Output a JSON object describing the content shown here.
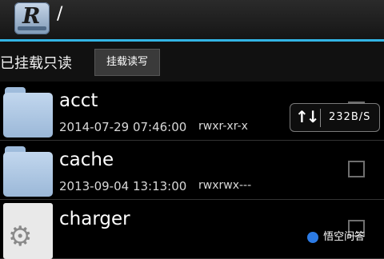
{
  "header": {
    "app_icon": "root-explorer-r-icon",
    "path": "/"
  },
  "mount_bar": {
    "status": "已挂载只读",
    "button_label": "挂载读写"
  },
  "files": [
    {
      "name": "acct",
      "date": "2014-07-29 07:46:00",
      "permissions": "rwxr-xr-x",
      "icon": "folder-icon"
    },
    {
      "name": "cache",
      "date": "2013-09-04 13:13:00",
      "permissions": "rwxrwx---",
      "icon": "folder-icon"
    },
    {
      "name": "charger",
      "date": "",
      "permissions": "",
      "icon": "settings-file-icon"
    }
  ],
  "speed_widget": {
    "arrows_icon": "up-down-arrows-icon",
    "value": "232B/S"
  },
  "watermark": {
    "text": "悟空问答"
  },
  "colors": {
    "accent": "#33b5e5",
    "folder": "#a9c5e4"
  }
}
